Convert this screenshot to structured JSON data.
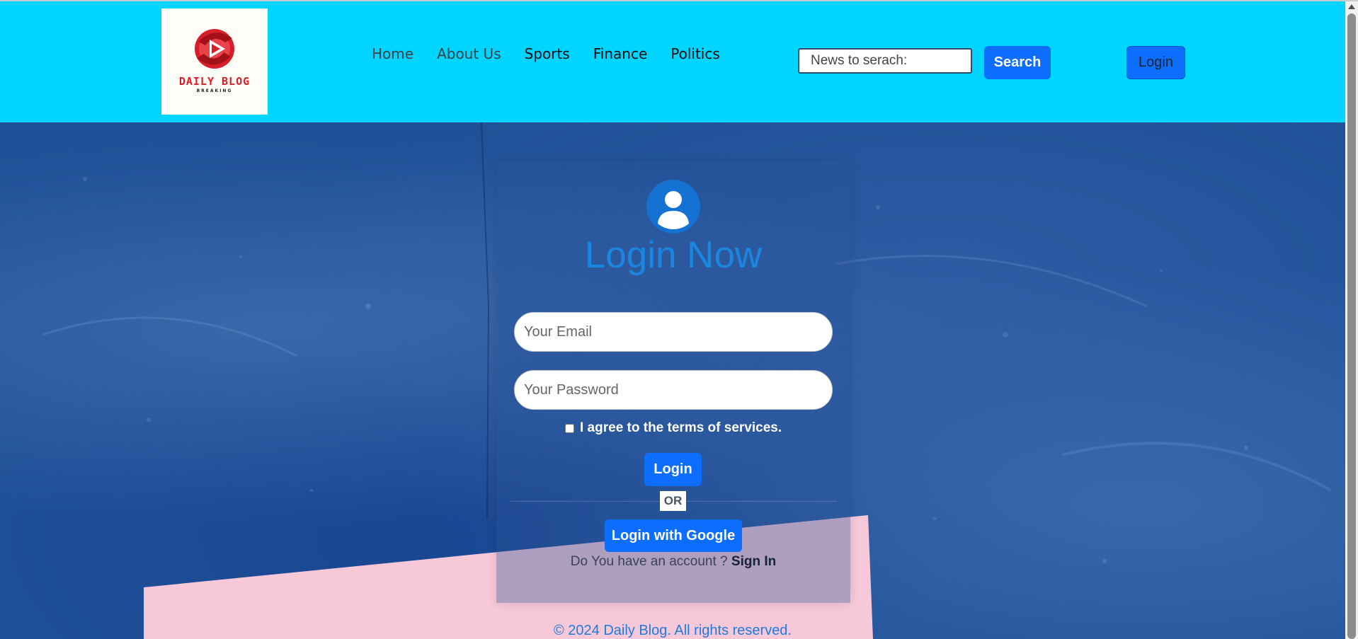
{
  "header": {
    "logo": {
      "title": "DAILY BLOG",
      "subtitle": "BREAKING"
    },
    "nav": [
      {
        "label": "Home"
      },
      {
        "label": "About Us"
      },
      {
        "label": "Sports"
      },
      {
        "label": "Finance"
      },
      {
        "label": "Politics"
      }
    ],
    "search": {
      "placeholder": "News to serach:",
      "button_label": "Search"
    },
    "login_button_label": "Login"
  },
  "login_card": {
    "title": "Login Now",
    "email_placeholder": "Your Email",
    "password_placeholder": "Your Password",
    "terms_label": "I agree to the terms of services.",
    "terms_checked": false,
    "login_button_label": "Login",
    "or_label": "OR",
    "google_button_label": "Login with Google",
    "account_prompt": "Do You have an account ?",
    "signin_label": "Sign In"
  },
  "footer": {
    "text": "© 2024 Daily Blog. All rights reserved."
  },
  "colors": {
    "header_bg": "#00d5ff",
    "accent": "#0d6efd",
    "title": "#1b86e0",
    "background": "#1e5097",
    "pink": "#f6c8d8"
  },
  "icons": [
    "play-logo-icon",
    "user-avatar-icon",
    "scroll-up-icon"
  ]
}
